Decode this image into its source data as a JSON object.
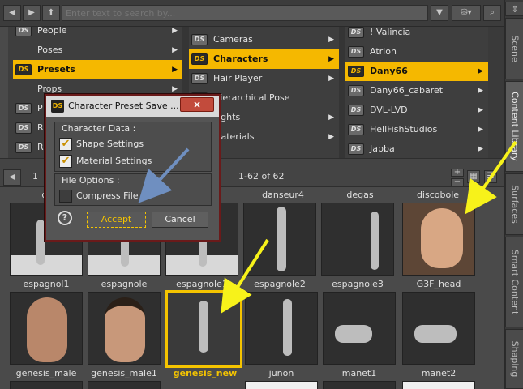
{
  "search": {
    "placeholder": "Enter text to search by..."
  },
  "side_tabs": [
    "Scene",
    "Content Library",
    "Surfaces",
    "Smart Content",
    "Shaping"
  ],
  "column1": {
    "items": [
      "People",
      "Poses",
      "Presets",
      "Props",
      "P",
      "R",
      "R"
    ],
    "selected": 2
  },
  "column2": {
    "items": [
      "Cameras",
      "Characters",
      "Hair Player",
      "Hierarchical Pose",
      "Lights",
      "Materials"
    ],
    "selected": 1
  },
  "column3": {
    "items": [
      "! Valincia",
      "Atrion",
      "Dany66",
      "Dany66_cabaret",
      "DVL-LVD",
      "HellFishStudios",
      "Jabba"
    ],
    "selected": 2
  },
  "folder_badge": "DS",
  "pagination": {
    "page": "1",
    "range": "1-62 of 62"
  },
  "top_labels": [
    "danseur4",
    "degas",
    "discobole"
  ],
  "row1": [
    "espagnol1",
    "espagnole",
    "espagnole1",
    "espagnole2",
    "espagnole3",
    "G3F_head"
  ],
  "row2": [
    "genesis_male",
    "genesis_male1",
    "genesis_new",
    "junon",
    "manet1",
    "manet2"
  ],
  "dialog": {
    "icon": "DS",
    "title": "Character Preset Save ...",
    "close": "×",
    "group1_title": "Character Data :",
    "shape_settings": "Shape Settings",
    "material_settings": "Material Settings",
    "group2_title": "File Options :",
    "compress_file": "Compress File",
    "help": "?",
    "accept": "Accept",
    "cancel": "Cancel",
    "checks": {
      "shape": true,
      "material": true,
      "compress": false
    }
  },
  "colors": {
    "accent": "#f5b800",
    "arrow_yellow": "#f7f21a",
    "arrow_blue": "#6f8fc0"
  }
}
